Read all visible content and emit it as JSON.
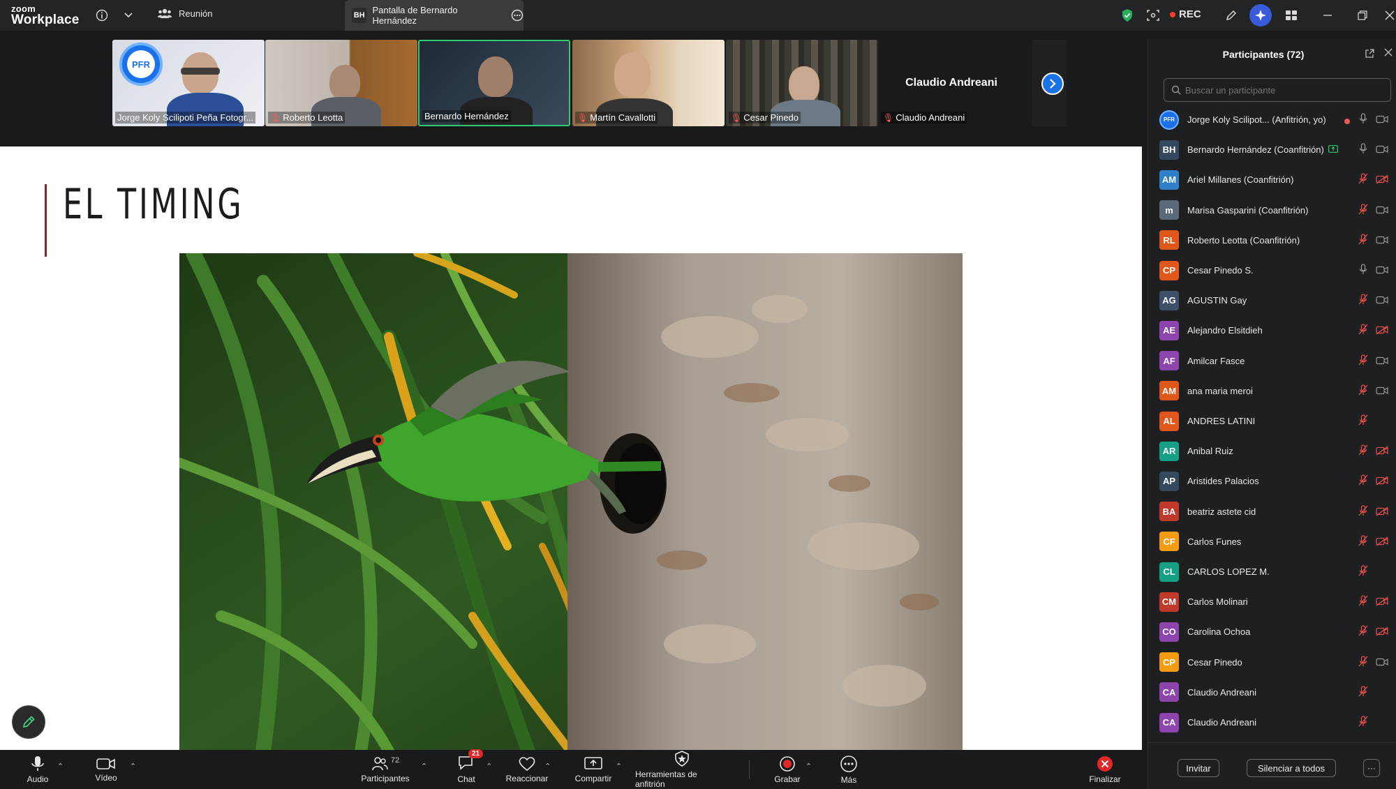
{
  "app": {
    "brand_line1": "zoom",
    "brand_line2": "Workplace"
  },
  "topbar": {
    "meeting_label": "Reunión",
    "share_initials": "BH",
    "share_label": "Pantalla de Bernardo Hernández",
    "rec_label": "REC"
  },
  "strip": {
    "tiles": [
      {
        "name": "Jorge Koly Scilipoti Peña Fotogr...",
        "muted": false
      },
      {
        "name": "Roberto Leotta",
        "muted": true
      },
      {
        "name": "Bernardo Hernández",
        "muted": false
      },
      {
        "name": "Martín Cavallotti",
        "muted": true
      },
      {
        "name": "Cesar Pinedo",
        "muted": true
      },
      {
        "name": "Claudio Andreani",
        "muted": true
      }
    ],
    "featured_name": "Claudio Andreani",
    "logo_text": "PFR"
  },
  "slide": {
    "title": "EL TIMING"
  },
  "panel": {
    "title": "Participantes (72)",
    "search_placeholder": "Buscar un participante",
    "participants": [
      {
        "initials": "PFR",
        "name": "Jorge Koly Scilipot... (Anfitrión, yo)",
        "color": "#1b72e8",
        "mic": "on",
        "cam": "on",
        "rec": true
      },
      {
        "initials": "BH",
        "name": "Bernardo Hernández (Coanfitrión)",
        "color": "#34495e",
        "mic": "on",
        "cam": "on",
        "share": true
      },
      {
        "initials": "AM",
        "name": "Ariel Millanes (Coanfitrión)",
        "color": "#2f80c9",
        "mic": "off",
        "cam": "off"
      },
      {
        "initials": "m",
        "name": "Marisa Gasparini (Coanfitrión)",
        "color": "#5a6a7a",
        "mic": "off",
        "cam": "on"
      },
      {
        "initials": "RL",
        "name": "Roberto Leotta (Coanfitrión)",
        "color": "#e0561b",
        "mic": "off",
        "cam": "on"
      },
      {
        "initials": "CP",
        "name": "Cesar Pinedo S.",
        "color": "#e0561b",
        "mic": "on",
        "cam": "on"
      },
      {
        "initials": "AG",
        "name": "AGUSTIN Gay",
        "color": "#3d5068",
        "mic": "off",
        "cam": "on"
      },
      {
        "initials": "AE",
        "name": "Alejandro Elsitdieh",
        "color": "#8e44ad",
        "mic": "off",
        "cam": "off"
      },
      {
        "initials": "AF",
        "name": "Amilcar Fasce",
        "color": "#8e44ad",
        "mic": "off",
        "cam": "on"
      },
      {
        "initials": "AM",
        "name": "ana maria meroi",
        "color": "#e0561b",
        "mic": "off",
        "cam": "on"
      },
      {
        "initials": "AL",
        "name": "ANDRES LATINI",
        "color": "#e0561b",
        "mic": "off",
        "cam": "none"
      },
      {
        "initials": "AR",
        "name": "Anibal Ruiz",
        "color": "#16a085",
        "mic": "off",
        "cam": "off"
      },
      {
        "initials": "AP",
        "name": "Aristides Palacios",
        "color": "#34495e",
        "mic": "off",
        "cam": "off"
      },
      {
        "initials": "BA",
        "name": "beatriz astete cid",
        "color": "#c0392b",
        "mic": "off",
        "cam": "off"
      },
      {
        "initials": "CF",
        "name": "Carlos Funes",
        "color": "#f39c12",
        "mic": "off",
        "cam": "off"
      },
      {
        "initials": "CL",
        "name": "CARLOS LOPEZ M.",
        "color": "#16a085",
        "mic": "off",
        "cam": "none"
      },
      {
        "initials": "CM",
        "name": "Carlos Molinari",
        "color": "#c0392b",
        "mic": "off",
        "cam": "off"
      },
      {
        "initials": "CO",
        "name": "Carolina Ochoa",
        "color": "#8e44ad",
        "mic": "off",
        "cam": "off"
      },
      {
        "initials": "CP",
        "name": "Cesar Pinedo",
        "color": "#f39c12",
        "mic": "off",
        "cam": "on"
      },
      {
        "initials": "CA",
        "name": "Claudio Andreani",
        "color": "#8e44ad",
        "mic": "off",
        "cam": "none"
      },
      {
        "initials": "CA",
        "name": "Claudio Andreani",
        "color": "#8e44ad",
        "mic": "off",
        "cam": "none"
      }
    ],
    "invite_label": "Invitar",
    "mute_all_label": "Silenciar a todos",
    "more_label": "···"
  },
  "toolbar": {
    "audio": "Audio",
    "video": "Vídeo",
    "participants": "Participantes",
    "participants_count": "72",
    "chat": "Chat",
    "chat_badge": "21",
    "react": "Reaccionar",
    "share": "Compartir",
    "host_tools": "Herramientas de anfitrión",
    "record": "Grabar",
    "more": "Más",
    "end": "Finalizar"
  },
  "colors": {
    "accent": "#1b72e8",
    "active_speaker": "#2ecc71",
    "muted": "#ff5a5a",
    "slide_accent": "#8b2232",
    "end": "#e02828"
  }
}
